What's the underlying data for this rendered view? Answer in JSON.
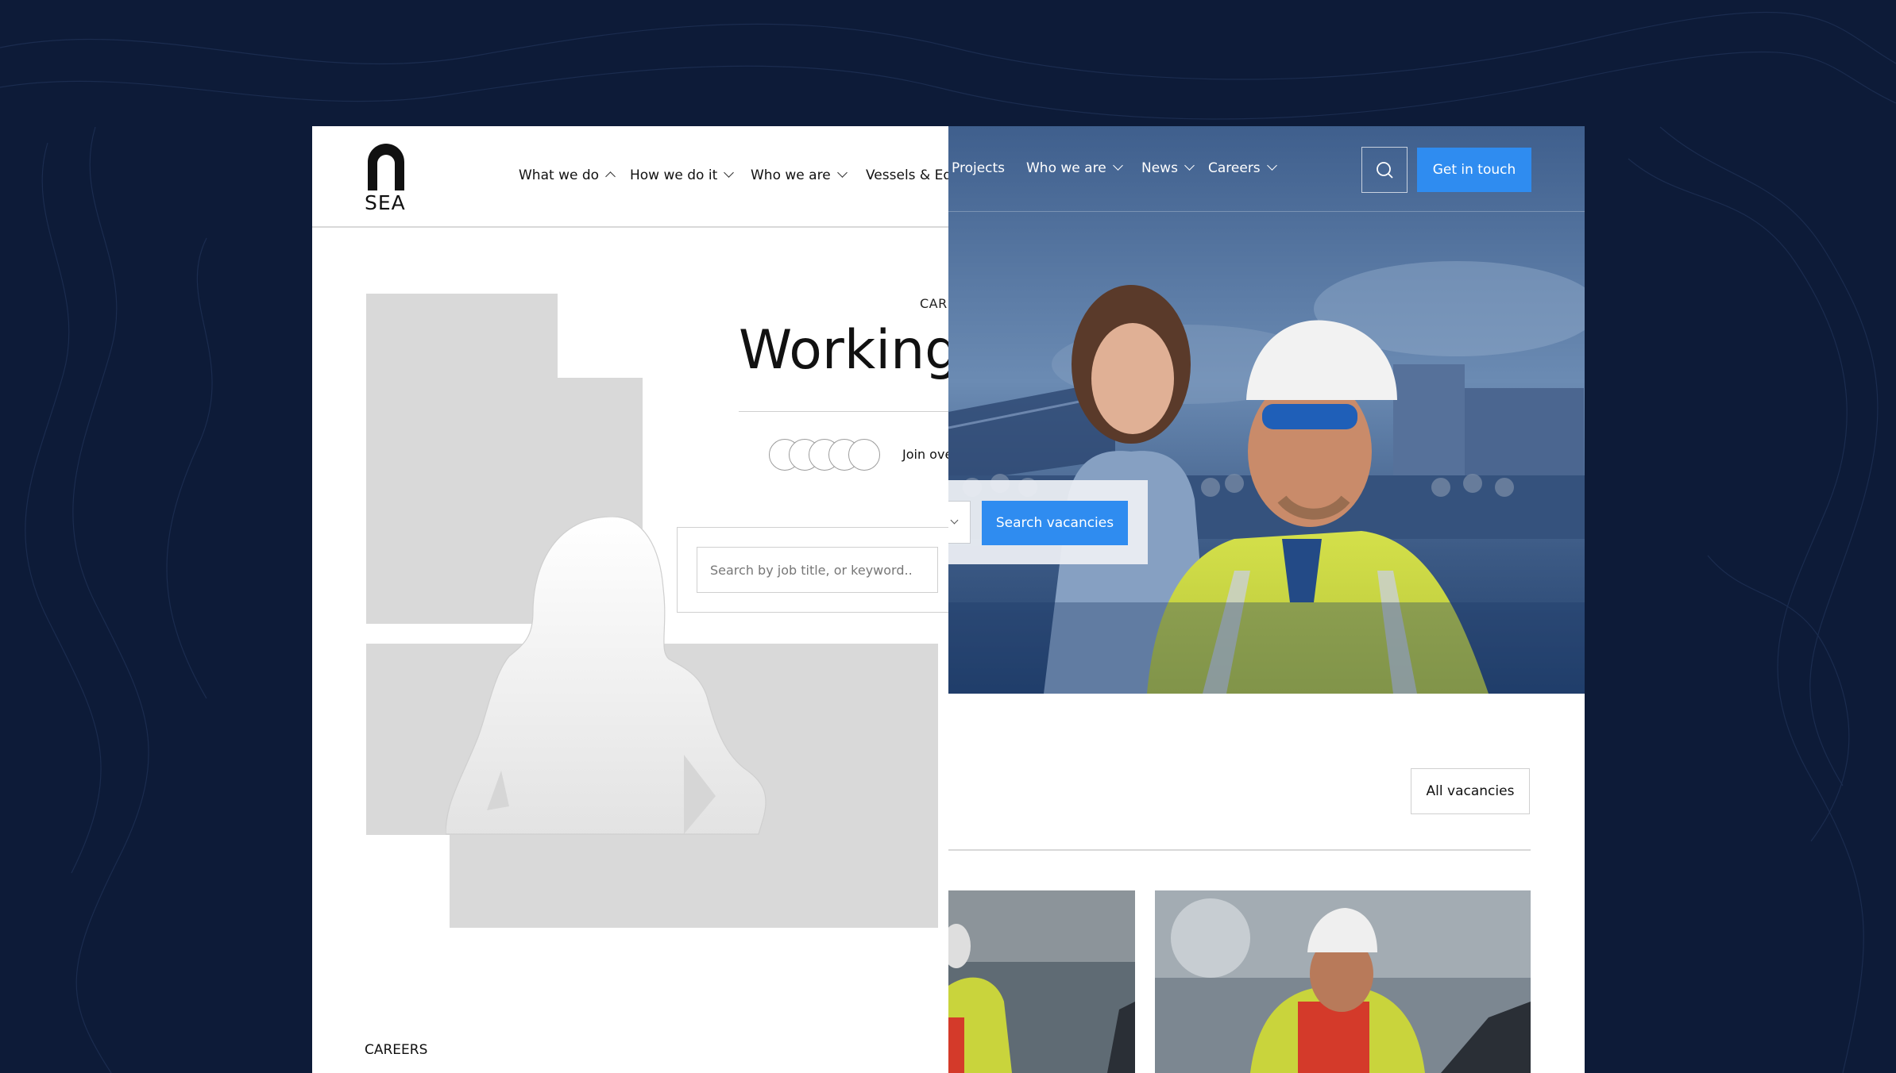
{
  "wireframe": {
    "logo_text": "SEA",
    "nav": [
      {
        "label": "What we do"
      },
      {
        "label": "How we do it"
      },
      {
        "label": "Who we are"
      },
      {
        "label": "Vessels & Equ"
      }
    ],
    "eyebrow": "CARI",
    "title": "Working",
    "join_text": "Join ove",
    "search_placeholder": "Search by job title, or keyword..",
    "bottom_eyebrow": "CAREERS"
  },
  "site": {
    "nav": [
      {
        "label": "Projects"
      },
      {
        "label": "Who we are"
      },
      {
        "label": "News"
      },
      {
        "label": "Careers"
      }
    ],
    "cta_label": "Get in touch",
    "search_button_label": "Search vacancies",
    "all_vacancies_label": "All vacancies"
  },
  "colors": {
    "background": "#0d1b38",
    "accent": "#2f8cf0",
    "placeholder_gray": "#d9d9d9"
  }
}
